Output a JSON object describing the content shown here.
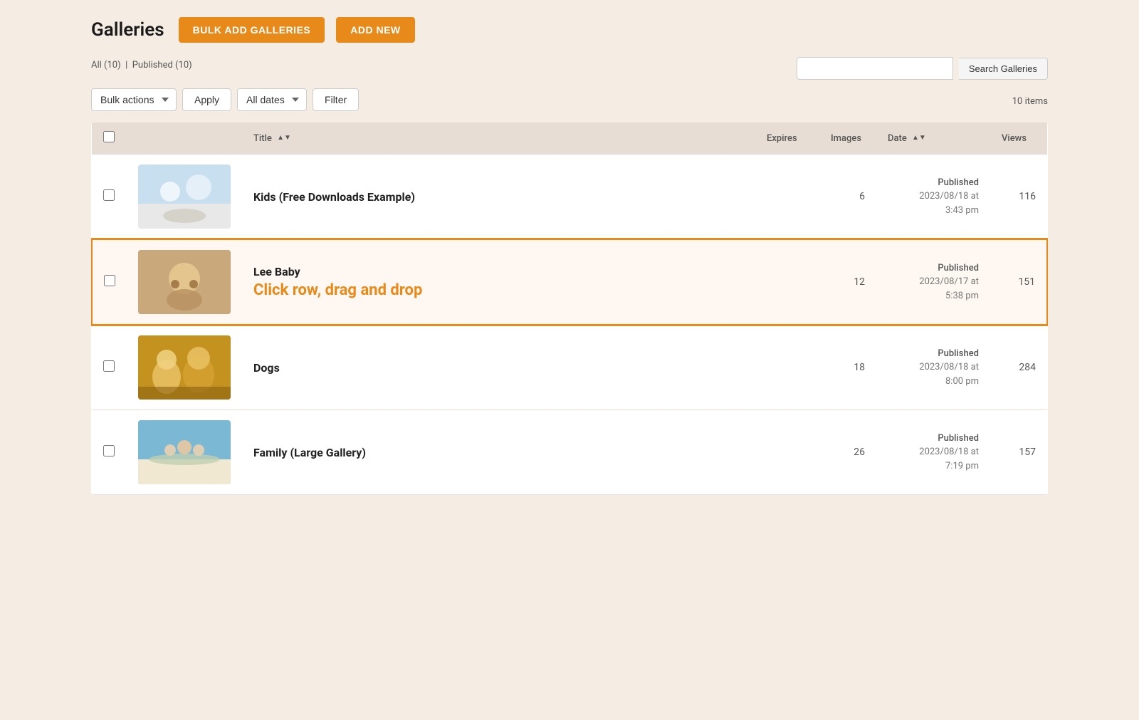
{
  "header": {
    "title": "Galleries",
    "btn_bulk": "BULK ADD GALLERIES",
    "btn_add": "ADD NEW"
  },
  "status_bar": {
    "all_label": "All",
    "all_count": "10",
    "published_label": "Published",
    "published_count": "10"
  },
  "toolbar": {
    "bulk_actions_label": "Bulk actions",
    "apply_label": "Apply",
    "all_dates_label": "All dates",
    "filter_label": "Filter",
    "items_count": "10 items",
    "search_placeholder": "",
    "search_btn": "Search Galleries"
  },
  "table": {
    "col_title": "Title",
    "col_expires": "Expires",
    "col_images": "Images",
    "col_date": "Date",
    "col_views": "Views"
  },
  "galleries": [
    {
      "id": 1,
      "title": "Kids (Free Downloads Example)",
      "expires": "",
      "images": "6",
      "status": "Published",
      "date": "2023/08/18 at\n3:43 pm",
      "views": "116",
      "highlighted": false,
      "drag_hint": "",
      "thumb_class": "thumb-kids"
    },
    {
      "id": 2,
      "title": "Lee Baby",
      "expires": "",
      "images": "12",
      "status": "Published",
      "date": "2023/08/17 at\n5:38 pm",
      "views": "151",
      "highlighted": true,
      "drag_hint": "Click row, drag and drop",
      "thumb_class": "thumb-baby"
    },
    {
      "id": 3,
      "title": "Dogs",
      "expires": "",
      "images": "18",
      "status": "Published",
      "date": "2023/08/18 at\n8:00 pm",
      "views": "284",
      "highlighted": false,
      "drag_hint": "",
      "thumb_class": "thumb-dogs"
    },
    {
      "id": 4,
      "title": "Family (Large Gallery)",
      "expires": "",
      "images": "26",
      "status": "Published",
      "date": "2023/08/18 at\n7:19 pm",
      "views": "157",
      "highlighted": false,
      "drag_hint": "",
      "thumb_class": "thumb-family"
    }
  ]
}
